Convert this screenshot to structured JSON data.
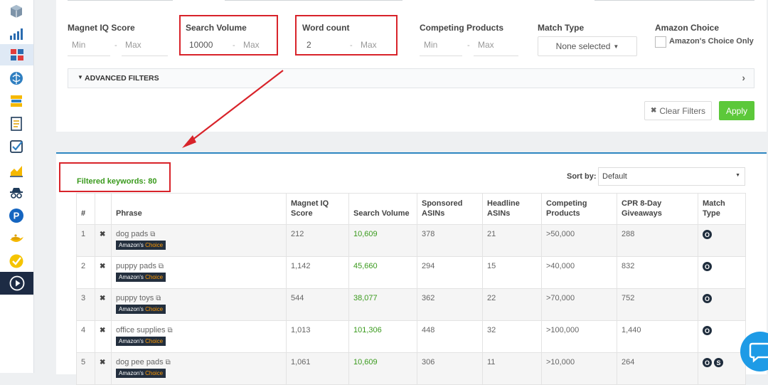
{
  "sidebar": {
    "icons": [
      "cube-icon",
      "bar-chart-icon",
      "puzzle-icon",
      "brain-icon",
      "stack-icon",
      "document-icon",
      "checklist-icon",
      "area-chart-icon",
      "spy-icon",
      "p-icon",
      "lamp-icon",
      "check-badge-icon",
      "play-icon"
    ]
  },
  "filters": {
    "magnet_iq": {
      "label": "Magnet IQ Score",
      "min": "Min",
      "max": "Max"
    },
    "search_volume": {
      "label": "Search Volume",
      "min": "10000",
      "max": "Max"
    },
    "word_count": {
      "label": "Word count",
      "min": "2",
      "max": "Max"
    },
    "competing_products": {
      "label": "Competing Products",
      "min": "Min",
      "max": "Max"
    },
    "match_type": {
      "label": "Match Type",
      "value": "None selected"
    },
    "amazon_choice": {
      "label": "Amazon Choice",
      "checkbox_label": "Amazon's Choice Only"
    },
    "dash": "-"
  },
  "advanced_filters": {
    "label": "ADVANCED FILTERS"
  },
  "buttons": {
    "clear": "Clear Filters",
    "apply": "Apply"
  },
  "results": {
    "filtered_label": "Filtered keywords: 80",
    "sort_label": "Sort by:",
    "sort_value": "Default"
  },
  "table": {
    "headers": [
      "#",
      "",
      "Phrase",
      "Magnet IQ Score",
      "Search Volume",
      "Sponsored ASINs",
      "Headline ASINs",
      "Competing Products",
      "CPR 8-Day Giveaways",
      "Match Type"
    ],
    "badge_prefix": "Amazon's",
    "badge_suffix": "Choice",
    "rows": [
      {
        "n": "1",
        "phrase": "dog pads",
        "iq": "212",
        "sv": "10,609",
        "sp": "378",
        "hl": "21",
        "cp": ">50,000",
        "cpr": "288",
        "mt": [
          "O"
        ]
      },
      {
        "n": "2",
        "phrase": "puppy pads",
        "iq": "1,142",
        "sv": "45,660",
        "sp": "294",
        "hl": "15",
        "cp": ">40,000",
        "cpr": "832",
        "mt": [
          "O"
        ]
      },
      {
        "n": "3",
        "phrase": "puppy toys",
        "iq": "544",
        "sv": "38,077",
        "sp": "362",
        "hl": "22",
        "cp": ">70,000",
        "cpr": "752",
        "mt": [
          "O"
        ]
      },
      {
        "n": "4",
        "phrase": "office supplies",
        "iq": "1,013",
        "sv": "101,306",
        "sp": "448",
        "hl": "32",
        "cp": ">100,000",
        "cpr": "1,440",
        "mt": [
          "O"
        ]
      },
      {
        "n": "5",
        "phrase": "dog pee pads",
        "iq": "1,061",
        "sv": "10,609",
        "sp": "306",
        "hl": "11",
        "cp": ">10,000",
        "cpr": "264",
        "mt": [
          "O",
          "S"
        ]
      }
    ]
  },
  "colors": {
    "accent": "#2e86c1",
    "apply": "#5cc83a",
    "highlight": "#d8232a",
    "green_text": "#3a9a1d"
  }
}
